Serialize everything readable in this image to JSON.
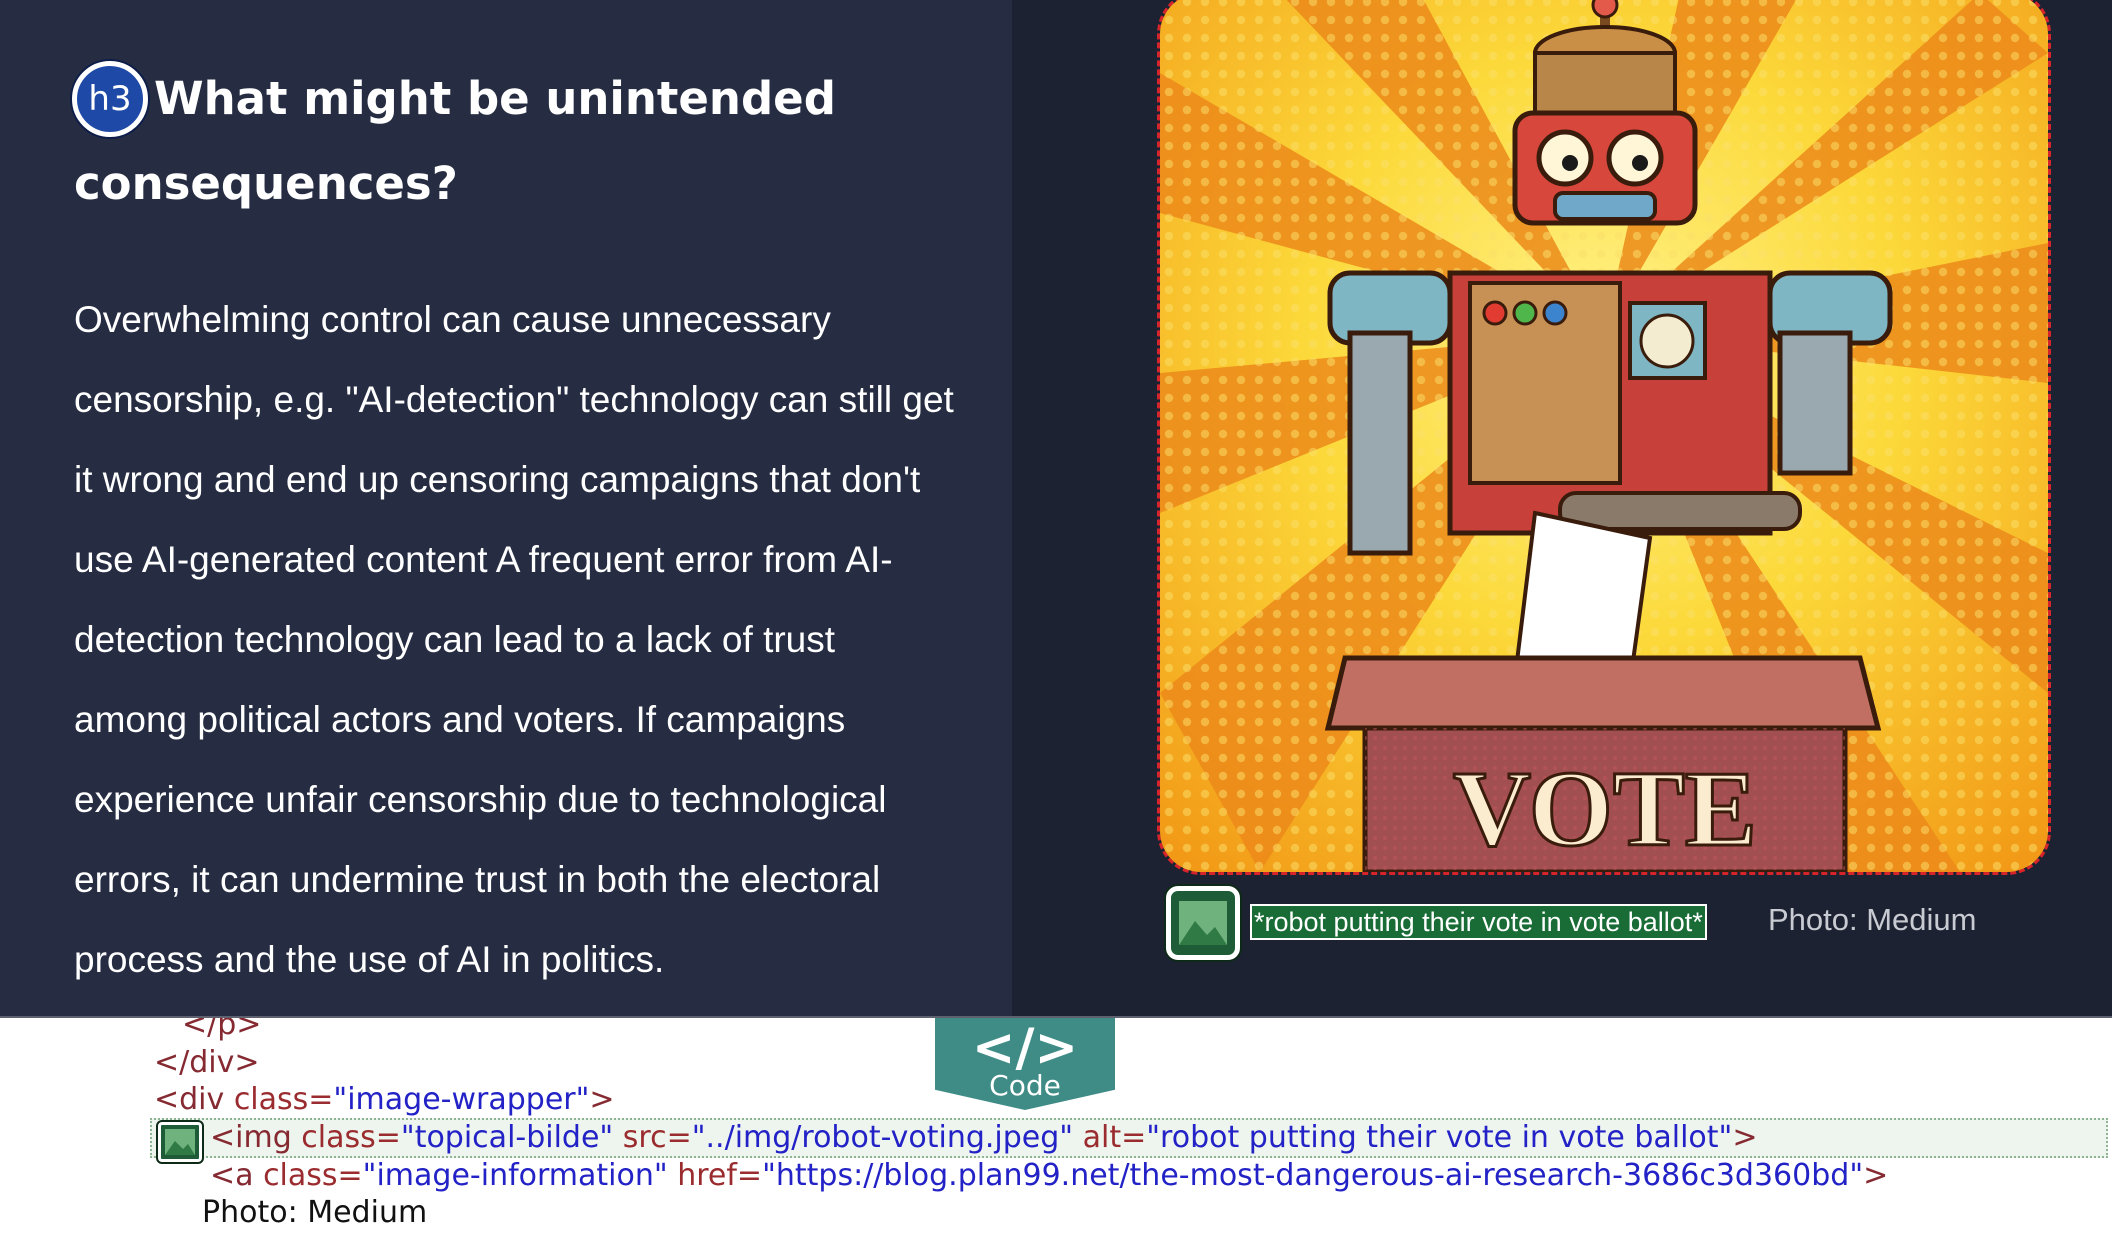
{
  "heading": {
    "badge": "h3",
    "line1": "What might be unintended",
    "line2": "consequences?"
  },
  "paragraph": "Overwhelming control can cause unnecessary censorship, e.g. \"AI-detection\" technology can still get it wrong and end up censoring campaigns that don't use AI-generated content A frequent error from AI-detection technology can lead to a lack of trust among political actors and voters. If campaigns experience unfair censorship due to technological errors, it can undermine trust in both the electoral process and the use of AI in politics.",
  "image": {
    "alt_display": "*robot putting their vote in vote ballot*",
    "box_text": "VOTE",
    "credit": "Photo: Medium"
  },
  "code_tab": {
    "glyph": "</>",
    "label": "Code"
  },
  "code": {
    "line0": "</p>",
    "line1": "</div>",
    "line2_tag_open": "<div ",
    "line2_attr": "class=",
    "line2_val": "\"image-wrapper\"",
    "line2_close": ">",
    "line3_tag": "<img ",
    "line3_a1": "class=",
    "line3_v1": "\"topical-bilde\"",
    "line3_a2": " src=",
    "line3_v2": "\"../img/robot-voting.jpeg\"",
    "line3_a3": " alt=",
    "line3_v3": "\"robot putting their vote in vote ballot\"",
    "line3_close": ">",
    "line4_tag": "<a ",
    "line4_a1": "class=",
    "line4_v1": "\"image-information\"",
    "line4_a2": " href=",
    "line4_v2": "\"https://blog.plan99.net/the-most-dangerous-ai-research-3686c3d360bd\"",
    "line4_close": ">",
    "line5": "Photo: Medium"
  },
  "colors": {
    "left_bg": "#262d42",
    "right_bg": "#1d2232",
    "tag": "#862a32",
    "value": "#2222c6",
    "tab": "#3f8c87"
  },
  "icons": [
    "h3-badge-icon",
    "image-icon",
    "code-icon"
  ]
}
